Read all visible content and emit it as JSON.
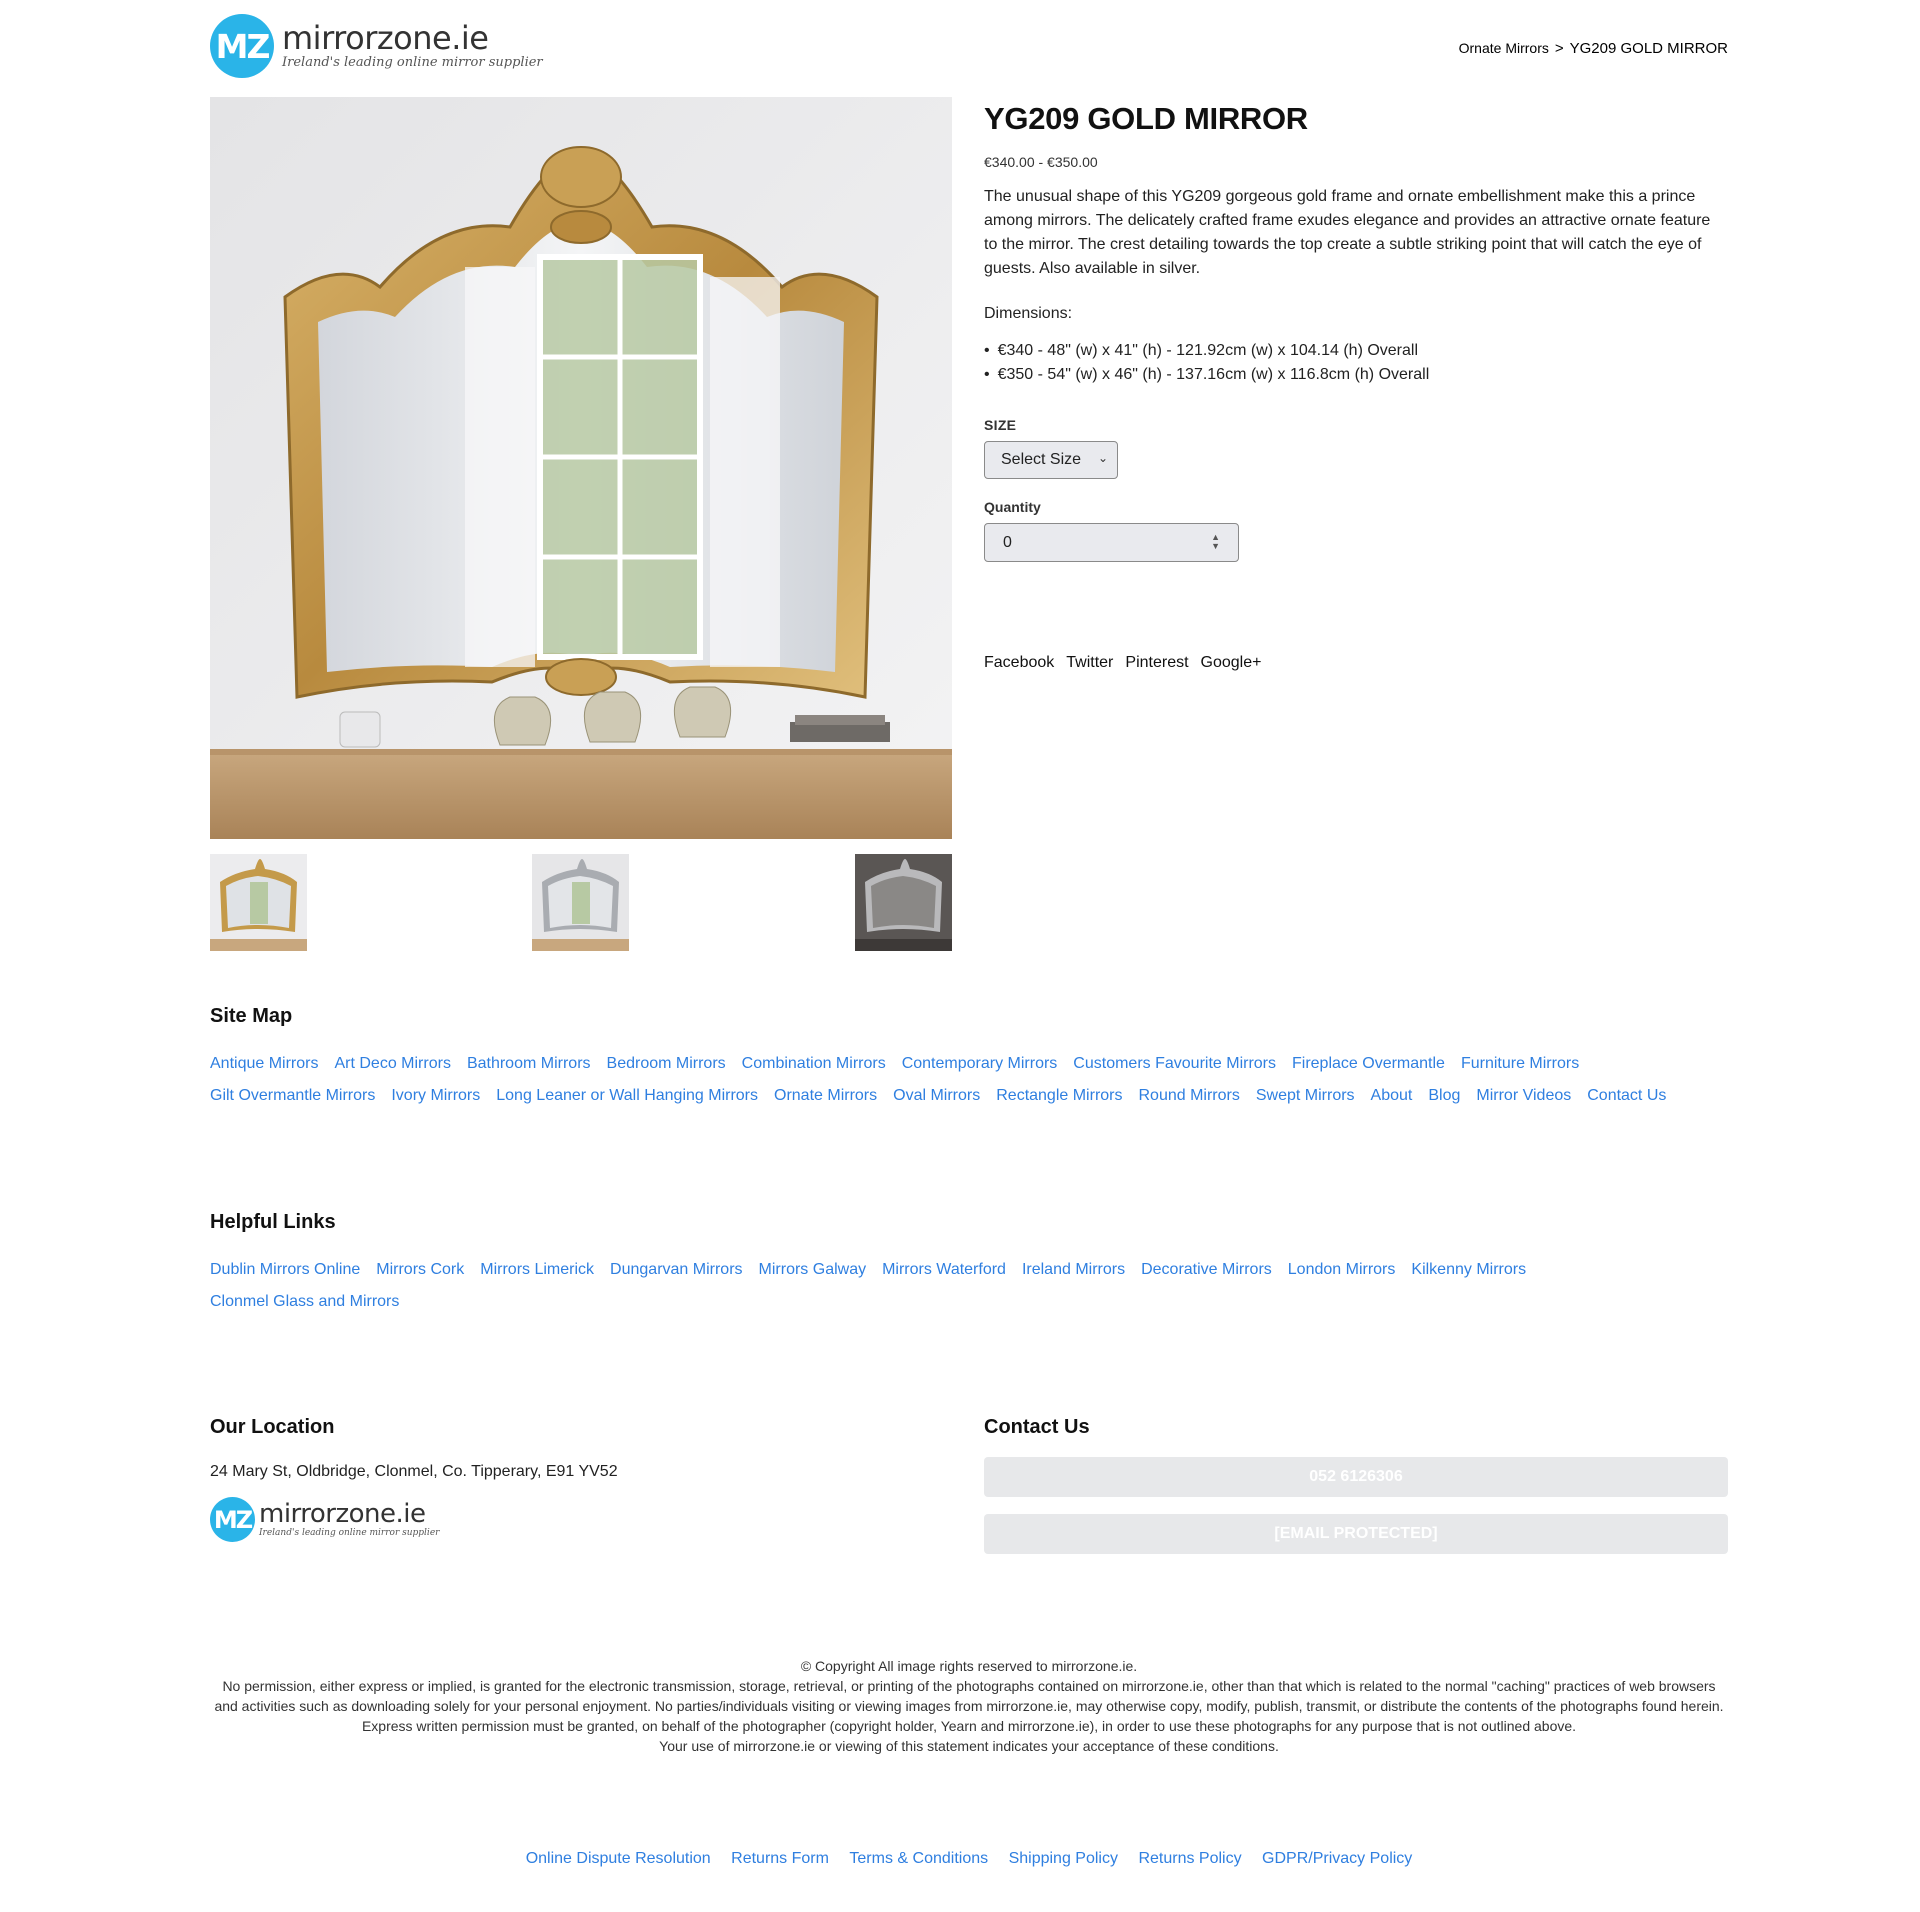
{
  "header": {
    "logo_mark": "MZ",
    "logo_name": "mirrorzone.ie",
    "logo_tagline": "Ireland's leading online mirror supplier",
    "breadcrumb": {
      "parent": "Ornate Mirrors",
      "separator": ">",
      "current": "YG209 GOLD MIRROR"
    }
  },
  "product": {
    "title": "YG209 GOLD MIRROR",
    "price": "€340.00 - €350.00",
    "description": "The unusual shape of this YG209 gorgeous gold frame and ornate embellishment make this a prince among mirrors. The delicately crafted frame exudes elegance and provides an attractive ornate feature to the mirror. The crest detailing towards the top create a subtle striking point that will catch the eye of guests. Also available in silver.",
    "dimensions_label": "Dimensions:",
    "dimensions": [
      "€340 - 48\" (w) x 41\" (h) - 121.92cm (w) x 104.14 (h) Overall",
      "€350 - 54\" (w) x 46\" (h) - 137.16cm (w) x 116.8cm (h) Overall"
    ],
    "size_label": "SIZE",
    "size_select_value": "Select Size",
    "quantity_label": "Quantity",
    "quantity_value": "0",
    "social": [
      "Facebook",
      "Twitter",
      "Pinterest",
      "Google+"
    ]
  },
  "colors": {
    "link": "#2f7fe0",
    "brand": "#2ab4e8",
    "frame_gold": "#c49a4a"
  },
  "site_map": {
    "title": "Site Map",
    "links": [
      "Antique Mirrors",
      "Art Deco Mirrors",
      "Bathroom Mirrors",
      "Bedroom Mirrors",
      "Combination Mirrors",
      "Contemporary Mirrors",
      "Customers Favourite Mirrors",
      "Fireplace Overmantle",
      "Furniture Mirrors",
      "Gilt Overmantle Mirrors",
      "Ivory Mirrors",
      "Long Leaner or Wall Hanging Mirrors",
      "Ornate Mirrors",
      "Oval Mirrors",
      "Rectangle Mirrors",
      "Round Mirrors",
      "Swept Mirrors",
      "About",
      "Blog",
      "Mirror Videos",
      "Contact Us"
    ]
  },
  "helpful_links": {
    "title": "Helpful Links",
    "links": [
      "Dublin Mirrors Online",
      "Mirrors Cork",
      "Mirrors Limerick",
      "Dungarvan Mirrors",
      "Mirrors Galway",
      "Mirrors Waterford",
      "Ireland Mirrors",
      "Decorative Mirrors",
      "London Mirrors",
      "Kilkenny Mirrors",
      "Clonmel Glass and Mirrors"
    ]
  },
  "location": {
    "title": "Our Location",
    "address": "24 Mary St, Oldbridge, Clonmel, Co. Tipperary, E91 YV52"
  },
  "contact": {
    "title": "Contact Us",
    "phone": "052 6126306",
    "email": "[EMAIL PROTECTED]"
  },
  "copyright": {
    "line1": "© Copyright All image rights reserved to mirrorzone.ie.",
    "line2": "No permission, either express or implied, is granted for the electronic transmission, storage, retrieval, or printing of the photographs contained on mirrorzone.ie, other than that which is related to the normal \"caching\" practices of web browsers and activities such as downloading solely for your personal enjoyment. No parties/individuals visiting or viewing images from mirrorzone.ie, may otherwise copy, modify, publish, transmit, or distribute the contents of the photographs found herein. Express written permission must be granted, on behalf of the photographer (copyright holder, Yearn and mirrorzone.ie), in order to use these photographs for any purpose that is not outlined above.",
    "line3": "Your use of mirrorzone.ie or viewing of this statement indicates your acceptance of these conditions."
  },
  "footer_links": [
    "Online Dispute Resolution",
    "Returns Form",
    "Terms & Conditions",
    "Shipping Policy",
    "Returns Policy",
    "GDPR/Privacy Policy"
  ]
}
